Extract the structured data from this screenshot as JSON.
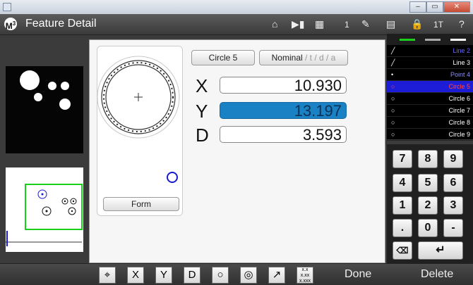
{
  "app": {
    "title": "Feature Detail",
    "logo": "M",
    "logo_sup": "3"
  },
  "toolbar": {
    "counter": "1",
    "tool_label": "1T",
    "help": "?"
  },
  "dialog": {
    "feature_name": "Circle 5",
    "nominal_label": "Nominal",
    "tolerance_tail": " / t / d / a",
    "form_button": "Form",
    "fields": [
      {
        "label": "X",
        "value": "10.930"
      },
      {
        "label": "Y",
        "value": "13.197"
      },
      {
        "label": "D",
        "value": "3.593"
      }
    ]
  },
  "feature_list": [
    {
      "icon": "line-icon",
      "name": "Line 2"
    },
    {
      "icon": "line-icon",
      "name": "Line 3"
    },
    {
      "icon": "point-icon",
      "name": "Point 4"
    },
    {
      "icon": "circle-icon",
      "name": "Circle 5",
      "selected": true
    },
    {
      "icon": "circle-icon",
      "name": "Circle 6"
    },
    {
      "icon": "circle-icon",
      "name": "Circle 7"
    },
    {
      "icon": "circle-icon",
      "name": "Circle 8"
    },
    {
      "icon": "circle-icon",
      "name": "Circle 9"
    }
  ],
  "keypad": {
    "keys": [
      "7",
      "8",
      "9",
      "4",
      "5",
      "6",
      "1",
      "2",
      "3",
      ".",
      "0",
      "-"
    ]
  },
  "bottom": {
    "tools": [
      "crosshair-icon",
      "X",
      "Y",
      "D",
      "circle-icon",
      "concentric-icon",
      "arrow-icon",
      "decimal-format-icon"
    ],
    "done": "Done",
    "delete": "Delete"
  },
  "colors": {
    "accent": "#1a82c4",
    "selected_row": "#1d1dd8"
  }
}
